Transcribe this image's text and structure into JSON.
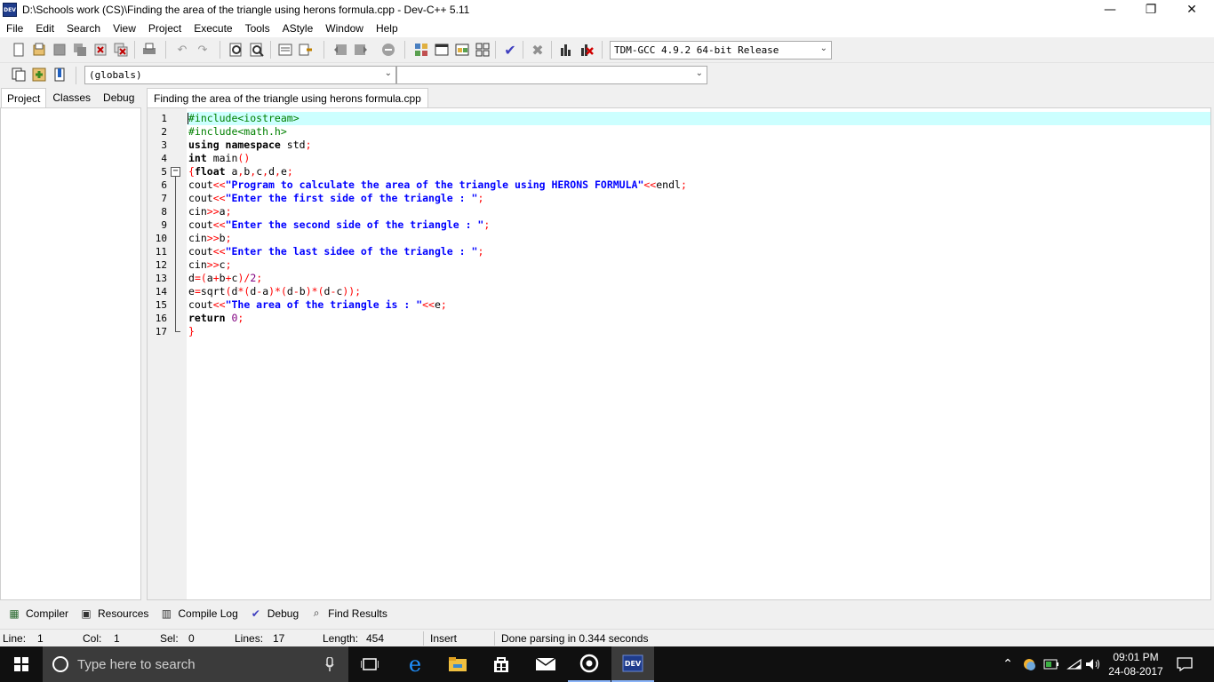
{
  "window": {
    "title": "D:\\Schools work (CS)\\Finding the area of the triangle using herons formula.cpp - Dev-C++ 5.11",
    "app_icon_text": "DEV",
    "minimize": "—",
    "restore": "❐",
    "close": "✕"
  },
  "menu": [
    "File",
    "Edit",
    "Search",
    "View",
    "Project",
    "Execute",
    "Tools",
    "AStyle",
    "Window",
    "Help"
  ],
  "toolbar": {
    "compiler_select": "TDM-GCC 4.9.2 64-bit Release",
    "scope_select": "(globals)",
    "member_select": ""
  },
  "left_tabs": [
    "Project",
    "Classes",
    "Debug"
  ],
  "editor_tab": "Finding the area of the triangle using herons formula.cpp",
  "code_lines": [
    {
      "n": "1",
      "tokens": [
        {
          "t": "#include<iostream>",
          "c": "pp"
        }
      ]
    },
    {
      "n": "2",
      "tokens": [
        {
          "t": "#include<math.h>",
          "c": "pp"
        }
      ]
    },
    {
      "n": "3",
      "tokens": [
        {
          "t": "using namespace",
          "c": "kw"
        },
        {
          "t": " std",
          "c": "id"
        },
        {
          "t": ";",
          "c": "sym"
        }
      ]
    },
    {
      "n": "4",
      "tokens": [
        {
          "t": "int",
          "c": "kw"
        },
        {
          "t": " main",
          "c": "id"
        },
        {
          "t": "()",
          "c": "sym"
        }
      ]
    },
    {
      "n": "5",
      "tokens": [
        {
          "t": "{",
          "c": "sym"
        },
        {
          "t": "float",
          "c": "kw"
        },
        {
          "t": " a",
          "c": "id"
        },
        {
          "t": ",",
          "c": "sym"
        },
        {
          "t": "b",
          "c": "id"
        },
        {
          "t": ",",
          "c": "sym"
        },
        {
          "t": "c",
          "c": "id"
        },
        {
          "t": ",",
          "c": "sym"
        },
        {
          "t": "d",
          "c": "id"
        },
        {
          "t": ",",
          "c": "sym"
        },
        {
          "t": "e",
          "c": "id"
        },
        {
          "t": ";",
          "c": "sym"
        }
      ]
    },
    {
      "n": "6",
      "tokens": [
        {
          "t": "cout",
          "c": "id"
        },
        {
          "t": "<<",
          "c": "sym"
        },
        {
          "t": "\"Program to calculate the area of the triangle using HERONS FORMULA\"",
          "c": "str"
        },
        {
          "t": "<<",
          "c": "sym"
        },
        {
          "t": "endl",
          "c": "id"
        },
        {
          "t": ";",
          "c": "sym"
        }
      ]
    },
    {
      "n": "7",
      "tokens": [
        {
          "t": "cout",
          "c": "id"
        },
        {
          "t": "<<",
          "c": "sym"
        },
        {
          "t": "\"Enter the first side of the triangle : \"",
          "c": "str"
        },
        {
          "t": ";",
          "c": "sym"
        }
      ]
    },
    {
      "n": "8",
      "tokens": [
        {
          "t": "cin",
          "c": "id"
        },
        {
          "t": ">>",
          "c": "sym"
        },
        {
          "t": "a",
          "c": "id"
        },
        {
          "t": ";",
          "c": "sym"
        }
      ]
    },
    {
      "n": "9",
      "tokens": [
        {
          "t": "cout",
          "c": "id"
        },
        {
          "t": "<<",
          "c": "sym"
        },
        {
          "t": "\"Enter the second side of the triangle : \"",
          "c": "str"
        },
        {
          "t": ";",
          "c": "sym"
        }
      ]
    },
    {
      "n": "10",
      "tokens": [
        {
          "t": "cin",
          "c": "id"
        },
        {
          "t": ">>",
          "c": "sym"
        },
        {
          "t": "b",
          "c": "id"
        },
        {
          "t": ";",
          "c": "sym"
        }
      ]
    },
    {
      "n": "11",
      "tokens": [
        {
          "t": "cout",
          "c": "id"
        },
        {
          "t": "<<",
          "c": "sym"
        },
        {
          "t": "\"Enter the last sidee of the triangle : \"",
          "c": "str"
        },
        {
          "t": ";",
          "c": "sym"
        }
      ]
    },
    {
      "n": "12",
      "tokens": [
        {
          "t": "cin",
          "c": "id"
        },
        {
          "t": ">>",
          "c": "sym"
        },
        {
          "t": "c",
          "c": "id"
        },
        {
          "t": ";",
          "c": "sym"
        }
      ]
    },
    {
      "n": "13",
      "tokens": [
        {
          "t": "d",
          "c": "id"
        },
        {
          "t": "=(",
          "c": "sym"
        },
        {
          "t": "a",
          "c": "id"
        },
        {
          "t": "+",
          "c": "sym"
        },
        {
          "t": "b",
          "c": "id"
        },
        {
          "t": "+",
          "c": "sym"
        },
        {
          "t": "c",
          "c": "id"
        },
        {
          "t": ")/",
          "c": "sym"
        },
        {
          "t": "2",
          "c": "num"
        },
        {
          "t": ";",
          "c": "sym"
        }
      ]
    },
    {
      "n": "14",
      "tokens": [
        {
          "t": "e",
          "c": "id"
        },
        {
          "t": "=",
          "c": "sym"
        },
        {
          "t": "sqrt",
          "c": "id"
        },
        {
          "t": "(",
          "c": "sym"
        },
        {
          "t": "d",
          "c": "id"
        },
        {
          "t": "*(",
          "c": "sym"
        },
        {
          "t": "d",
          "c": "id"
        },
        {
          "t": "-",
          "c": "sym"
        },
        {
          "t": "a",
          "c": "id"
        },
        {
          "t": ")*(",
          "c": "sym"
        },
        {
          "t": "d",
          "c": "id"
        },
        {
          "t": "-",
          "c": "sym"
        },
        {
          "t": "b",
          "c": "id"
        },
        {
          "t": ")*(",
          "c": "sym"
        },
        {
          "t": "d",
          "c": "id"
        },
        {
          "t": "-",
          "c": "sym"
        },
        {
          "t": "c",
          "c": "id"
        },
        {
          "t": "));",
          "c": "sym"
        }
      ]
    },
    {
      "n": "15",
      "tokens": [
        {
          "t": "cout",
          "c": "id"
        },
        {
          "t": "<<",
          "c": "sym"
        },
        {
          "t": "\"The area of the triangle is : \"",
          "c": "str"
        },
        {
          "t": "<<",
          "c": "sym"
        },
        {
          "t": "e",
          "c": "id"
        },
        {
          "t": ";",
          "c": "sym"
        }
      ]
    },
    {
      "n": "16",
      "tokens": [
        {
          "t": "return",
          "c": "kw"
        },
        {
          "t": " ",
          "c": "id"
        },
        {
          "t": "0",
          "c": "num"
        },
        {
          "t": ";",
          "c": "sym"
        }
      ]
    },
    {
      "n": "17",
      "tokens": [
        {
          "t": "}",
          "c": "sym"
        }
      ]
    }
  ],
  "fold_marker": "−",
  "bottom_tabs": [
    {
      "label": "Compiler",
      "icon": "compiler-icon",
      "glyph": "▦"
    },
    {
      "label": "Resources",
      "icon": "resources-icon",
      "glyph": "▣"
    },
    {
      "label": "Compile Log",
      "icon": "compile-log-icon",
      "glyph": "▥"
    },
    {
      "label": "Debug",
      "icon": "debug-icon",
      "glyph": "✔"
    },
    {
      "label": "Find Results",
      "icon": "find-results-icon",
      "glyph": "⌕"
    }
  ],
  "status": {
    "line_label": "Line:",
    "line_value": "1",
    "col_label": "Col:",
    "col_value": "1",
    "sel_label": "Sel:",
    "sel_value": "0",
    "lines_label": "Lines:",
    "lines_value": "17",
    "length_label": "Length:",
    "length_value": "454",
    "mode": "Insert",
    "message": "Done parsing in 0.344 seconds"
  },
  "taskbar": {
    "search_placeholder": "Type here to search",
    "clock_time": "09:01 PM",
    "clock_date": "24-08-2017"
  },
  "colors": {
    "current_line": "#ccffff",
    "preprocessor": "#008000",
    "string": "#0000ff",
    "symbol": "#ff0000",
    "taskbar": "#101010"
  }
}
